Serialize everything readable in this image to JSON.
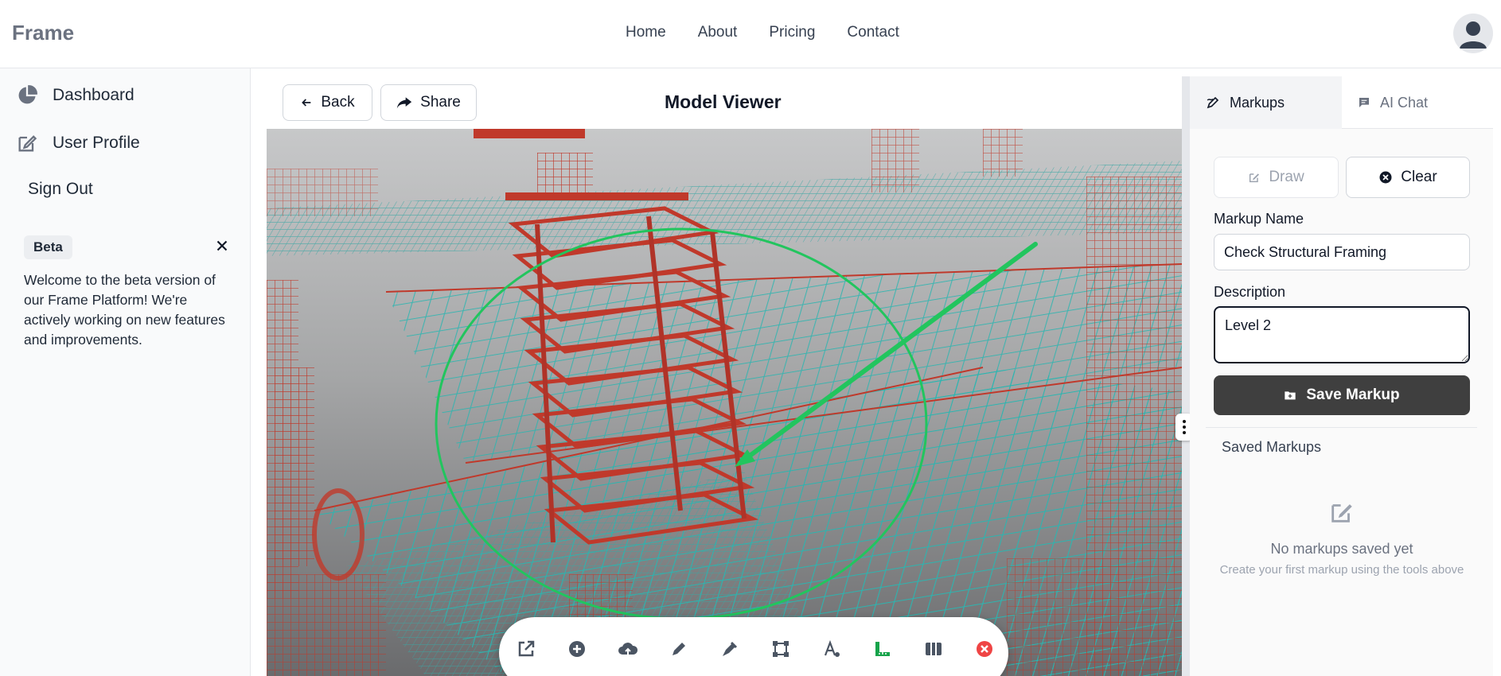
{
  "app": {
    "brand": "Frame"
  },
  "nav": {
    "items": [
      "Home",
      "About",
      "Pricing",
      "Contact"
    ]
  },
  "sidebar": {
    "items": [
      {
        "label": "Dashboard",
        "icon": "pie-chart-icon"
      },
      {
        "label": "User Profile",
        "icon": "edit-icon"
      },
      {
        "label": "Sign Out"
      }
    ],
    "beta": {
      "badge": "Beta",
      "text": "Welcome to the beta version of our Frame Platform! We're actively working on new features and improvements."
    }
  },
  "viewer": {
    "back_label": "Back",
    "share_label": "Share",
    "title": "Model Viewer",
    "tools": [
      "external-link-icon",
      "plus-circle-icon",
      "cloud-upload-icon",
      "pen-icon",
      "marker-icon",
      "vector-square-icon",
      "text-icon",
      "ruler-icon",
      "columns-icon",
      "close-circle-icon"
    ]
  },
  "panel": {
    "tabs": {
      "markups": "Markups",
      "ai_chat": "AI Chat"
    },
    "draw_label": "Draw",
    "clear_label": "Clear",
    "markup_name_label": "Markup Name",
    "markup_name_value": "Check Structural Framing",
    "description_label": "Description",
    "description_value": "Level 2",
    "save_label": "Save Markup",
    "saved_title": "Saved Markups",
    "empty_title": "No markups saved yet",
    "empty_sub": "Create your first markup using the tools above"
  },
  "colors": {
    "accent_dark": "#3f3f3f",
    "markup_green": "#22c55e",
    "structure_red": "#c0392b",
    "structure_teal": "#2bb5b0",
    "close_red": "#ef4444"
  }
}
